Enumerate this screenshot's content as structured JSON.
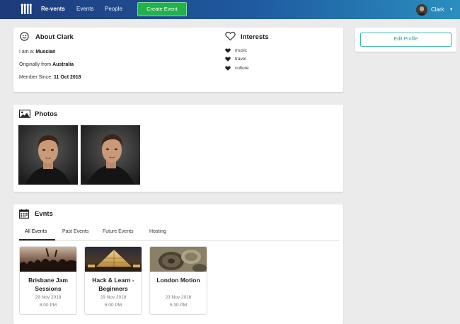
{
  "nav": {
    "brand": "Re-vents",
    "events": "Events",
    "people": "People",
    "create_event": "Create Event"
  },
  "user": {
    "name": "Clark"
  },
  "about": {
    "title": "About Clark",
    "role_label": "I am a:",
    "role_value": "Muscian",
    "origin_label": "Originally from",
    "origin_value": "Australia",
    "member_label": "Member Since:",
    "member_value": "11 Oct 2018"
  },
  "interests": {
    "title": "Interests",
    "items": [
      "music",
      "travel",
      "culture"
    ]
  },
  "photos": {
    "title": "Photos"
  },
  "events": {
    "title": "Evnts",
    "tabs": [
      "All Events",
      "Past Events",
      "Future Events",
      "Hosting"
    ],
    "items": [
      {
        "title": "Brisbane Jam Sessions",
        "date": "29 Nov 2018",
        "time": "8:00 PM"
      },
      {
        "title": "Hack & Learn - Beginners",
        "date": "29 Nov 2018",
        "time": "6:00 PM"
      },
      {
        "title": "London Motion",
        "date": "23 Nov 2018",
        "time": "5:30 PM"
      }
    ]
  },
  "sidebar": {
    "edit_profile": "Edit Profile"
  },
  "colors": {
    "primary_green": "#22b14c",
    "accent_teal": "#3bb8ad",
    "header_dark": "#1d3a7a",
    "header_light": "#2a8fbf"
  }
}
